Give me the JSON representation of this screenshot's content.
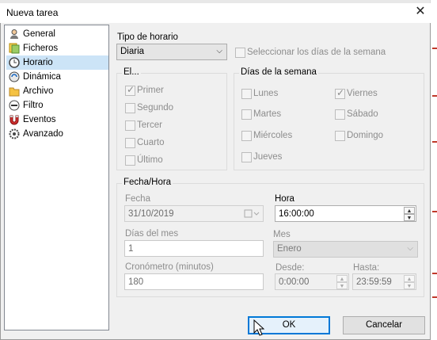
{
  "window": {
    "title": "Nueva tarea",
    "close_icon": "close-icon"
  },
  "nav": {
    "items": [
      {
        "label": "General",
        "icon": "person-icon",
        "selected": false
      },
      {
        "label": "Ficheros",
        "icon": "files-icon",
        "selected": false
      },
      {
        "label": "Horario",
        "icon": "clock-icon",
        "selected": true
      },
      {
        "label": "Dinámica",
        "icon": "dynamic-icon",
        "selected": false
      },
      {
        "label": "Archivo",
        "icon": "folder-icon",
        "selected": false
      },
      {
        "label": "Filtro",
        "icon": "filter-icon",
        "selected": false
      },
      {
        "label": "Eventos",
        "icon": "magnet-icon",
        "selected": false
      },
      {
        "label": "Avanzado",
        "icon": "gear-icon",
        "selected": false
      }
    ]
  },
  "schedule": {
    "type_label": "Tipo de horario",
    "type_value": "Diaria",
    "select_days_label": "Seleccionar los días de la semana",
    "select_days_checked": false
  },
  "el_group": {
    "legend": "El...",
    "options": [
      {
        "label": "Primer",
        "checked": true
      },
      {
        "label": "Segundo",
        "checked": false
      },
      {
        "label": "Tercer",
        "checked": false
      },
      {
        "label": "Cuarto",
        "checked": false
      },
      {
        "label": "Último",
        "checked": false
      }
    ]
  },
  "days_group": {
    "legend": "Días de la semana",
    "left": [
      {
        "label": "Lunes",
        "checked": false
      },
      {
        "label": "Martes",
        "checked": false
      },
      {
        "label": "Miércoles",
        "checked": false
      },
      {
        "label": "Jueves",
        "checked": false
      }
    ],
    "right": [
      {
        "label": "Viernes",
        "checked": true
      },
      {
        "label": "Sábado",
        "checked": false
      },
      {
        "label": "Domingo",
        "checked": false
      }
    ]
  },
  "datetime_group": {
    "legend": "Fecha/Hora",
    "fecha_label": "Fecha",
    "fecha_value": "31/10/2019",
    "hora_label": "Hora",
    "hora_value": "16:00:00",
    "dias_mes_label": "Días del mes",
    "dias_mes_value": "1",
    "mes_label": "Mes",
    "mes_value": "Enero",
    "crono_label": "Cronómetro (minutos)",
    "crono_value": "180",
    "desde_label": "Desde:",
    "desde_value": "0:00:00",
    "hasta_label": "Hasta:",
    "hasta_value": "23:59:59"
  },
  "buttons": {
    "ok": "OK",
    "cancel": "Cancelar"
  }
}
